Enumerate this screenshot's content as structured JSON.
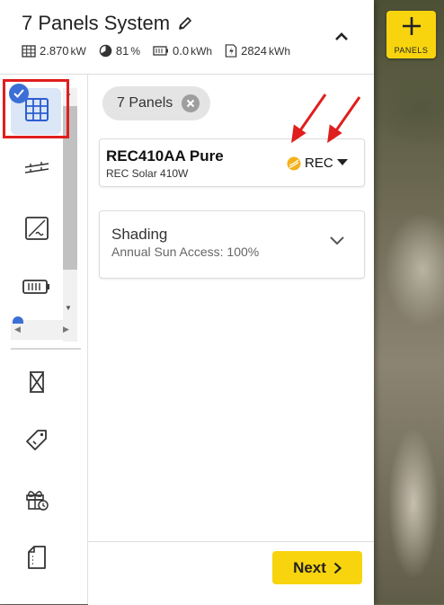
{
  "header": {
    "title": "7 Panels System",
    "stats": {
      "power_value": "2.870",
      "power_unit": "kW",
      "offset_value": "81",
      "offset_unit": "%",
      "battery_value": "0.0",
      "battery_unit": "kWh",
      "production_value": "2824",
      "production_unit": "kWh"
    }
  },
  "add_panels": {
    "label": "PANELS"
  },
  "chip": {
    "label": "7 Panels"
  },
  "module": {
    "name": "REC410AA Pure",
    "subtitle": "REC Solar 410W",
    "brand": "REC"
  },
  "shading": {
    "title": "Shading",
    "subtitle": "Annual Sun Access: 100%"
  },
  "footer": {
    "next_label": "Next"
  },
  "colors": {
    "accent_yellow": "#f8d40e",
    "active_blue": "#3b6fd6",
    "annotation_red": "#e01e1e"
  }
}
